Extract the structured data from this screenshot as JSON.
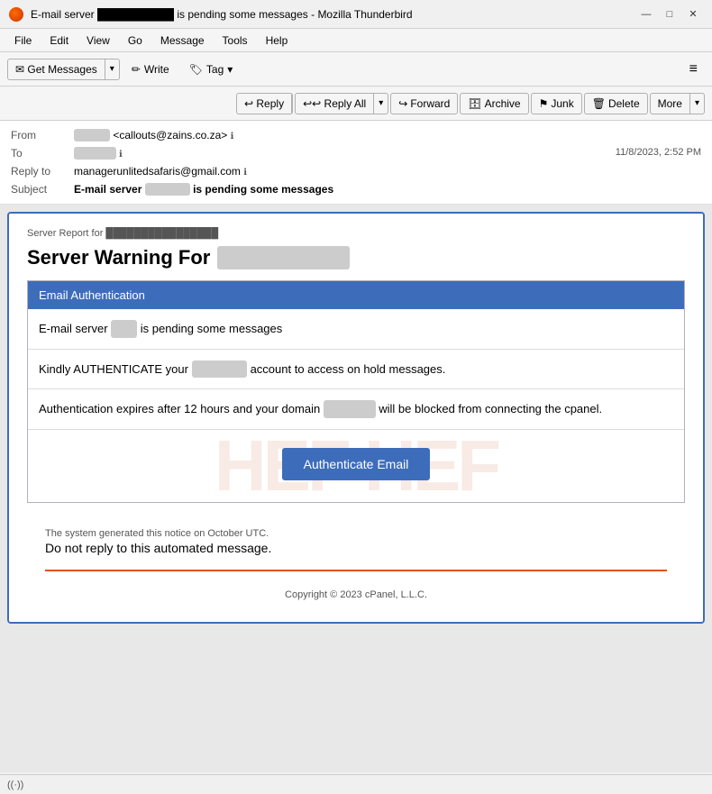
{
  "window": {
    "title": "E-mail server ██████████ is pending some messages - Mozilla Thunderbird",
    "controls": {
      "minimize": "—",
      "maximize": "□",
      "close": "✕"
    }
  },
  "menubar": {
    "items": [
      "File",
      "Edit",
      "View",
      "Go",
      "Message",
      "Tools",
      "Help"
    ]
  },
  "toolbar": {
    "get_messages_label": "Get Messages",
    "write_label": "Write",
    "tag_label": "Tag",
    "hamburger": "≡"
  },
  "action_toolbar": {
    "reply_label": "Reply",
    "reply_all_label": "Reply All",
    "forward_label": "Forward",
    "archive_label": "Archive",
    "junk_label": "Junk",
    "delete_label": "Delete",
    "more_label": "More"
  },
  "email_header": {
    "from_label": "From",
    "from_name": "██████████",
    "from_email": "<callouts@zains.co.za>",
    "to_label": "To",
    "to_value": "████████████",
    "date": "11/8/2023, 2:52 PM",
    "reply_to_label": "Reply to",
    "reply_to_email": "managerunlitedsafaris@gmail.com",
    "subject_label": "Subject",
    "subject_text": "E-mail server ██████████ is pending some messages"
  },
  "email_body": {
    "server_report_header": "Server Report for ████████████████",
    "warning_title_text": "Server Warning For",
    "warning_email_blurred": "████████████████████",
    "auth_box_header": "Email Authentication",
    "row1_text": "E-mail server",
    "row1_blurred": "████████",
    "row1_suffix": "is pending some messages",
    "row2_text": "Kindly AUTHENTICATE your",
    "row2_blurred": "████████████████",
    "row2_suffix": "account to access on hold messages.",
    "row3_text": "Authentication expires after 12 hours  and your domain",
    "row3_blurred": "████████████████",
    "row3_suffix": "will be blocked from connecting the cpanel.",
    "cta_button": "Authenticate Email",
    "watermark": "HEF HEF",
    "footer_system_notice": "The system generated this notice on October UTC.",
    "footer_no_reply": "Do not reply to this automated message.",
    "footer_copyright": "Copyright © 2023 cPanel, L.L.C."
  },
  "statusbar": {
    "wifi_icon": "((·))",
    "text": ""
  }
}
